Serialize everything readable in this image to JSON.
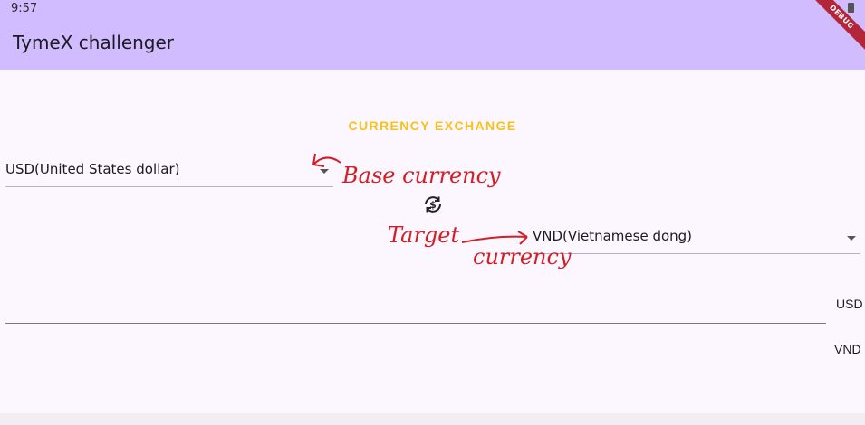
{
  "status_bar": {
    "time": "9:57"
  },
  "app_bar": {
    "title": "TymeX challenger",
    "debug_banner": "DEBUG"
  },
  "exchange": {
    "section_title": "CURRENCY EXCHANGE",
    "base_currency": "USD(United States dollar)",
    "target_currency": "VND(Vietnamese dong)",
    "amount_value": "",
    "base_unit": "USD",
    "target_unit": "VND",
    "swap_icon": "currency-exchange-icon"
  },
  "annotations": {
    "base_note": "Base currency",
    "target_note_word1": "Target",
    "target_note_word2": "currency"
  },
  "colors": {
    "app_bar": "#d1bcff",
    "background": "#fcf6ff",
    "section_title": "#f7c21a",
    "annotation": "#d21e26",
    "debug_ribbon": "#b3263a"
  }
}
